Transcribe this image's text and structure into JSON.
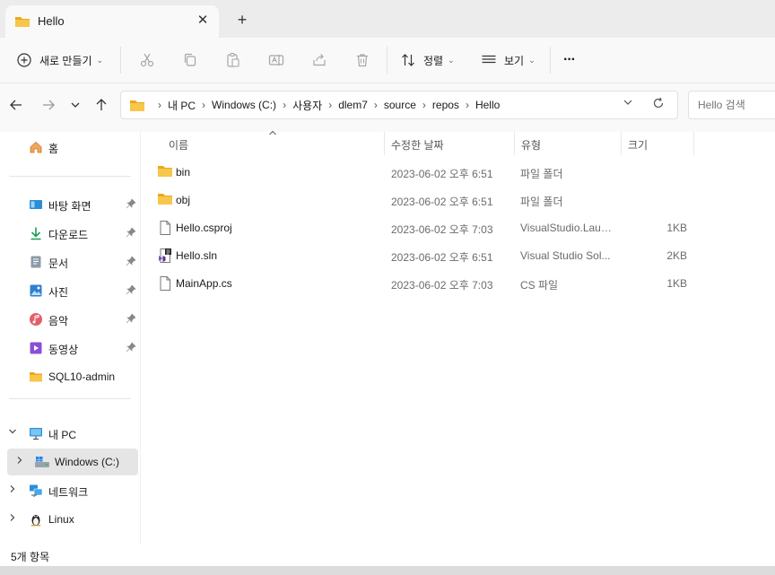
{
  "tab": {
    "title": "Hello",
    "close": "✕",
    "new_tab": "+"
  },
  "toolbar": {
    "new_label": "새로 만들기",
    "sort_label": "정렬",
    "view_label": "보기",
    "more": "···",
    "chevron": "⌄"
  },
  "address": {
    "crumbs": [
      "내 PC",
      "Windows (C:)",
      "사용자",
      "dlem7",
      "source",
      "repos",
      "Hello"
    ],
    "separator": "›",
    "search_placeholder": "Hello 검색"
  },
  "nav": {
    "home": "홈",
    "quick": [
      {
        "label": "바탕 화면",
        "icon": "desktop-icon",
        "pinned": true
      },
      {
        "label": "다운로드",
        "icon": "download-icon",
        "pinned": true
      },
      {
        "label": "문서",
        "icon": "documents-icon",
        "pinned": true
      },
      {
        "label": "사진",
        "icon": "pictures-icon",
        "pinned": true
      },
      {
        "label": "음악",
        "icon": "music-icon",
        "pinned": true
      },
      {
        "label": "동영상",
        "icon": "videos-icon",
        "pinned": true
      },
      {
        "label": "SQL10-admin",
        "icon": "folder-icon",
        "pinned": false
      }
    ],
    "this_pc": "내 PC",
    "drive": "Windows (C:)",
    "network": "네트워크",
    "linux": "Linux"
  },
  "columns": {
    "name": "이름",
    "modified": "수정한 날짜",
    "type": "유형",
    "size": "크기"
  },
  "files": [
    {
      "name": "bin",
      "modified": "2023-06-02 오후 6:51",
      "type": "파일 폴더",
      "size": "",
      "icon": "folder-icon"
    },
    {
      "name": "obj",
      "modified": "2023-06-02 오후 6:51",
      "type": "파일 폴더",
      "size": "",
      "icon": "folder-icon"
    },
    {
      "name": "Hello.csproj",
      "modified": "2023-06-02 오후 7:03",
      "type": "VisualStudio.Laun...",
      "size": "1KB",
      "icon": "file-icon"
    },
    {
      "name": "Hello.sln",
      "modified": "2023-06-02 오후 6:51",
      "type": "Visual Studio Sol...",
      "size": "2KB",
      "icon": "sln-file-icon"
    },
    {
      "name": "MainApp.cs",
      "modified": "2023-06-02 오후 7:03",
      "type": "CS 파일",
      "size": "1KB",
      "icon": "file-icon"
    }
  ],
  "status": {
    "count_text": "5개 항목"
  },
  "colors": {
    "folder": "#f7c64a",
    "folder_dark": "#e8a91c",
    "accent": "#0067c0"
  }
}
